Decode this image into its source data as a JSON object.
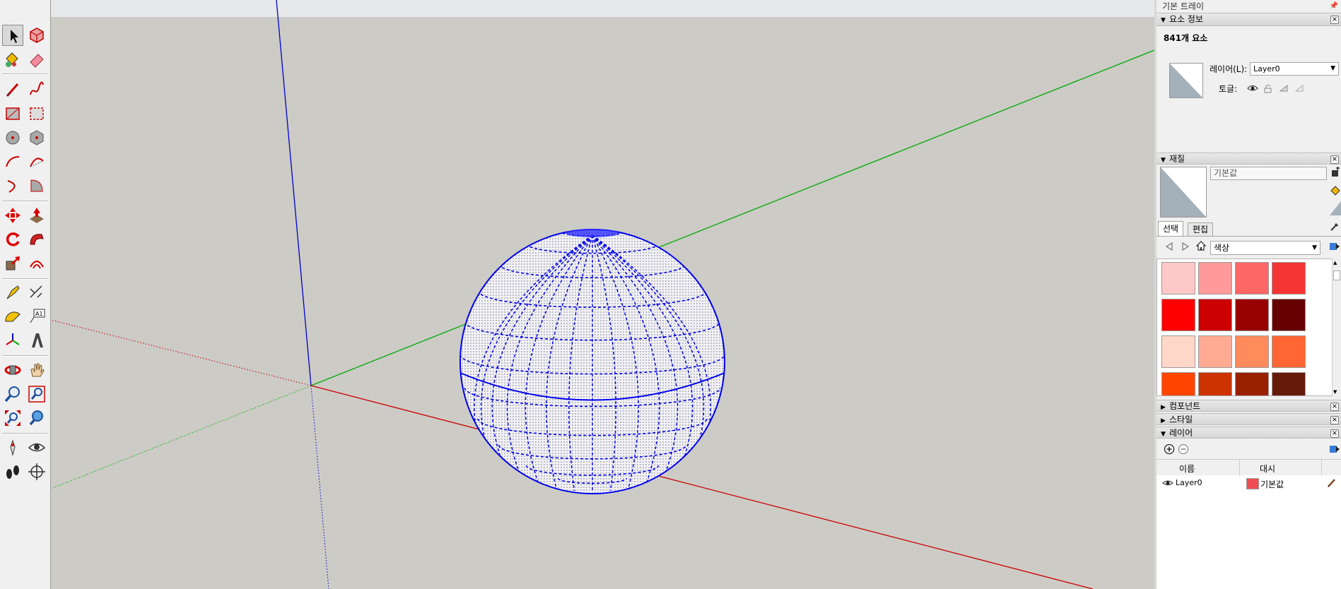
{
  "tray": {
    "title": "기본 트레이",
    "entity_info": {
      "header": "요소 정보",
      "count": "841개 요소",
      "layer_label": "레이어(L):",
      "layer_value": "Layer0",
      "toggle_label": "토글:"
    },
    "materials": {
      "header": "재질",
      "name_value": "기본값",
      "tabs": [
        "선택",
        "편집"
      ],
      "library_value": "색상",
      "swatches": [
        "#ffc8c8",
        "#ff9a9a",
        "#ff6666",
        "#f53434",
        "#ff0000",
        "#cc0000",
        "#990000",
        "#660000",
        "#ffd7c8",
        "#ffab94",
        "#ff8a5c",
        "#ff6633",
        "#ff4500",
        "#cc3300",
        "#992000",
        "#661a0a"
      ]
    },
    "collapsed_panels": [
      "컴포넌트",
      "스타일"
    ],
    "layers": {
      "header": "레이어",
      "col_name": "이름",
      "col_color": "대시",
      "rows": [
        {
          "name": "Layer0",
          "color": "#ef4e55",
          "color_label": "기본값"
        }
      ]
    }
  },
  "colors": {
    "viewport_bg": "#cccbc6",
    "sphere_edges": "#0000ee",
    "axis_red": "#cc0000",
    "axis_green": "#00aa00",
    "axis_blue": "#0000cc"
  },
  "tools": [
    "select-icon",
    "make-component-icon",
    "paint-bucket-icon",
    "eraser-icon",
    "line-icon",
    "freehand-icon",
    "rectangle-icon",
    "rotated-rectangle-icon",
    "circle-icon",
    "polygon-icon",
    "arc-icon",
    "two-point-arc-icon",
    "three-point-arc-icon",
    "pie-icon",
    "move-icon",
    "push-pull-icon",
    "rotate-icon",
    "follow-me-icon",
    "scale-icon",
    "offset-icon",
    "tape-measure-icon",
    "dimension-icon",
    "protractor-icon",
    "text-icon",
    "axes-icon",
    "3d-text-icon",
    "orbit-icon",
    "pan-icon",
    "zoom-icon",
    "zoom-window-icon",
    "zoom-extents-icon",
    "previous-view-icon",
    "position-camera-icon",
    "look-around-icon",
    "walk-icon",
    "section-plane-icon"
  ]
}
